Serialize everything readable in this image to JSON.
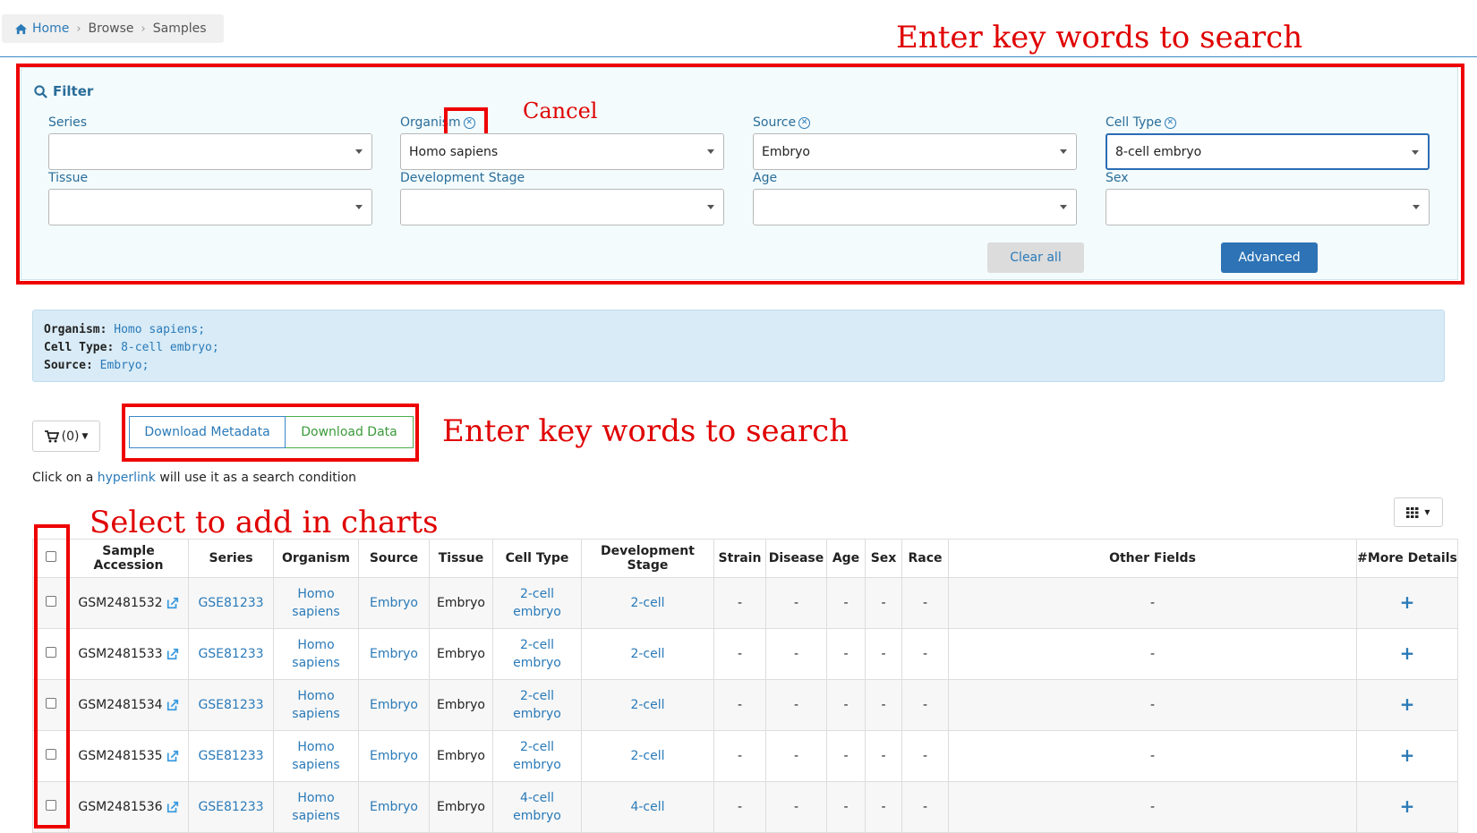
{
  "breadcrumb": {
    "home": "Home",
    "browse": "Browse",
    "samples": "Samples"
  },
  "annotations": {
    "filter_note": "Enter key words to search",
    "cancel_note": "Cancel",
    "download_note": "Enter key words to search",
    "select_note": "Select to add in charts"
  },
  "filter": {
    "title": "Filter",
    "fields": {
      "series": {
        "label": "Series",
        "value": ""
      },
      "organism": {
        "label": "Organism",
        "value": "Homo sapiens"
      },
      "source": {
        "label": "Source",
        "value": "Embryo"
      },
      "cell_type": {
        "label": "Cell Type",
        "value": "8-cell embryo"
      },
      "tissue": {
        "label": "Tissue",
        "value": ""
      },
      "development_stage": {
        "label": "Development Stage",
        "value": ""
      },
      "age": {
        "label": "Age",
        "value": ""
      },
      "sex": {
        "label": "Sex",
        "value": ""
      }
    },
    "clear_label": "Clear all",
    "advanced_label": "Advanced"
  },
  "summary": {
    "organism_key": "Organism:",
    "organism_val": "Homo sapiens;",
    "cell_type_key": "Cell Type:",
    "cell_type_val": "8-cell embryo;",
    "source_key": "Source:",
    "source_val": "Embryo;"
  },
  "cart": {
    "count": "(0)"
  },
  "downloads": {
    "metadata": "Download Metadata",
    "data": "Download Data"
  },
  "hint": {
    "prefix": "Click on a",
    "link": "hyperlink",
    "suffix": "will use it as a search condition"
  },
  "table": {
    "headers": [
      "Sample Accession",
      "Series",
      "Organism",
      "Source",
      "Tissue",
      "Cell Type",
      "Development Stage",
      "Strain",
      "Disease",
      "Age",
      "Sex",
      "Race",
      "Other Fields",
      "#More Details"
    ],
    "rows": [
      {
        "accession": "GSM2481532",
        "series": "GSE81233",
        "organism1": "Homo",
        "organism2": "sapiens",
        "source": "Embryo",
        "tissue": "Embryo",
        "cell1": "2-cell",
        "cell2": "embryo",
        "stage": "2-cell",
        "strain": "-",
        "disease": "-",
        "age": "-",
        "sex": "-",
        "race": "-",
        "other": "-"
      },
      {
        "accession": "GSM2481533",
        "series": "GSE81233",
        "organism1": "Homo",
        "organism2": "sapiens",
        "source": "Embryo",
        "tissue": "Embryo",
        "cell1": "2-cell",
        "cell2": "embryo",
        "stage": "2-cell",
        "strain": "-",
        "disease": "-",
        "age": "-",
        "sex": "-",
        "race": "-",
        "other": "-"
      },
      {
        "accession": "GSM2481534",
        "series": "GSE81233",
        "organism1": "Homo",
        "organism2": "sapiens",
        "source": "Embryo",
        "tissue": "Embryo",
        "cell1": "2-cell",
        "cell2": "embryo",
        "stage": "2-cell",
        "strain": "-",
        "disease": "-",
        "age": "-",
        "sex": "-",
        "race": "-",
        "other": "-"
      },
      {
        "accession": "GSM2481535",
        "series": "GSE81233",
        "organism1": "Homo",
        "organism2": "sapiens",
        "source": "Embryo",
        "tissue": "Embryo",
        "cell1": "2-cell",
        "cell2": "embryo",
        "stage": "2-cell",
        "strain": "-",
        "disease": "-",
        "age": "-",
        "sex": "-",
        "race": "-",
        "other": "-"
      },
      {
        "accession": "GSM2481536",
        "series": "GSE81233",
        "organism1": "Homo",
        "organism2": "sapiens",
        "source": "Embryo",
        "tissue": "Embryo",
        "cell1": "4-cell",
        "cell2": "embryo",
        "stage": "4-cell",
        "strain": "-",
        "disease": "-",
        "age": "-",
        "sex": "-",
        "race": "-",
        "other": "-"
      }
    ]
  },
  "colors": {
    "accent": "#2a7ab8",
    "primary_button": "#2d73b5",
    "annotation": "#e00000",
    "download_data": "#3a9a3a"
  }
}
